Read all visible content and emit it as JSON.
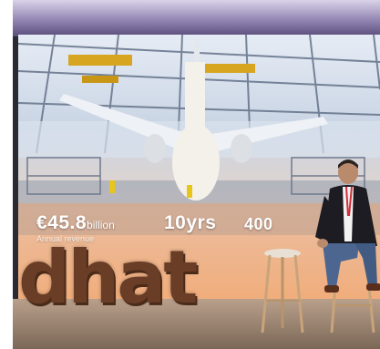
{
  "scene": "event stage",
  "slide": {
    "stat1_value": "€45.8",
    "stat1_unit": "billion",
    "stat1_caption": "Annual revenue",
    "stat2_value": "10yrs",
    "stat3_value": "400"
  },
  "logo_text": "dhat",
  "colors": {
    "logo": "#6a3e26",
    "screen_glow": "#f2b98b",
    "stage_dark": "#2a2a33"
  }
}
